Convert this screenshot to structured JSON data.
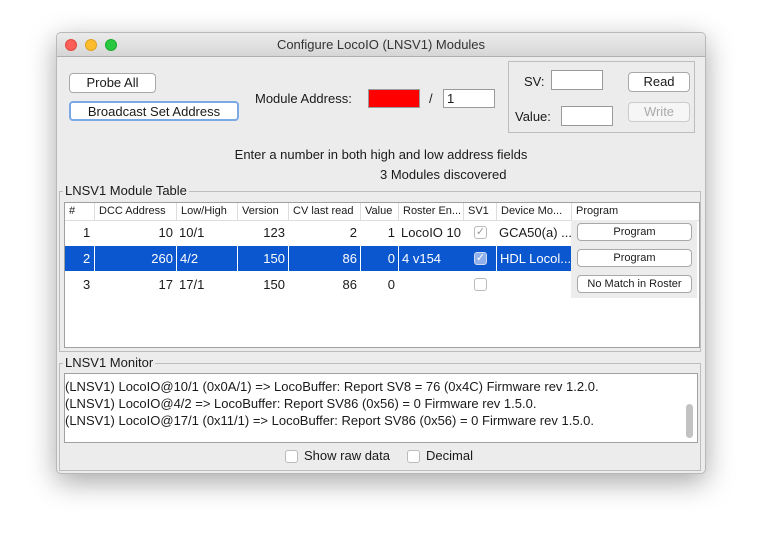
{
  "window": {
    "title": "Configure LocoIO (LNSV1) Modules"
  },
  "toolbar": {
    "probe_all": "Probe All",
    "broadcast": "Broadcast Set Address",
    "module_address_label": "Module Address:",
    "address_high": "",
    "separator": "/",
    "address_low": "1"
  },
  "sv_panel": {
    "sv_label": "SV:",
    "sv_value": "",
    "value_label": "Value:",
    "value_value": "",
    "read": "Read",
    "write": "Write"
  },
  "status": {
    "hint": "Enter a number in both high and low address fields",
    "discovered": "3 Modules discovered"
  },
  "table": {
    "title": "LNSV1 Module Table",
    "columns": [
      "#",
      "DCC Address",
      "Low/High",
      "Version",
      "CV last read",
      "Value",
      "Roster En...",
      "SV1",
      "Device Mo...",
      "Program"
    ],
    "rows": [
      {
        "num": "1",
        "dcc": "10",
        "lowhigh": "10/1",
        "version": "123",
        "cv": "2",
        "value": "1",
        "roster": "LocoIO 10",
        "sv1": true,
        "device": "GCA50(a) ...",
        "program": "Program",
        "selected": false
      },
      {
        "num": "2",
        "dcc": "260",
        "lowhigh": "4/2",
        "version": "150",
        "cv": "86",
        "value": "0",
        "roster": "4 v154",
        "sv1": true,
        "device": "HDL Locol...",
        "program": "Program",
        "selected": true
      },
      {
        "num": "3",
        "dcc": "17",
        "lowhigh": "17/1",
        "version": "150",
        "cv": "86",
        "value": "0",
        "roster": "",
        "sv1": false,
        "device": "",
        "program": "No Match in Roster",
        "selected": false
      }
    ]
  },
  "monitor": {
    "title": "LNSV1 Monitor",
    "lines": [
      "(LNSV1) LocoIO@10/1 (0x0A/1) => LocoBuffer: Report SV8 = 76 (0x4C) Firmware rev 1.2.0.",
      "(LNSV1) LocoIO@4/2 => LocoBuffer: Report SV86 (0x56) = 0 Firmware rev 1.5.0.",
      "(LNSV1) LocoIO@17/1 (0x11/1) => LocoBuffer: Report SV86 (0x56) = 0 Firmware rev 1.5.0."
    ],
    "show_raw": "Show raw data",
    "show_raw_checked": false,
    "decimal": "Decimal",
    "decimal_checked": false
  },
  "colors": {
    "selection": "#0b57d0",
    "address_error": "#ff0000"
  }
}
